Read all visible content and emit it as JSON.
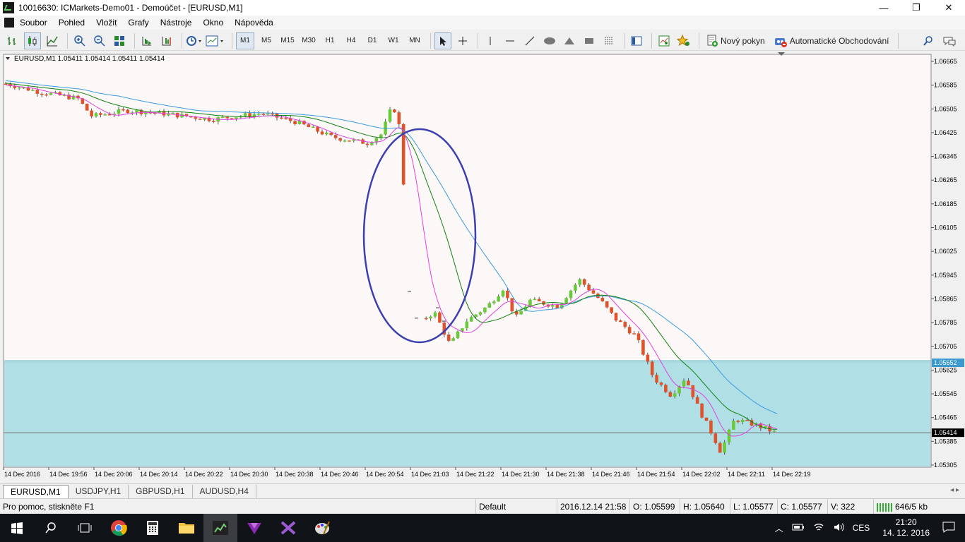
{
  "window": {
    "title": "10016630: ICMarkets-Demo01 - Demoúčet - [EURUSD,M1]",
    "controls": {
      "minimize": "—",
      "maximize": "❐",
      "close": "✕"
    },
    "mdi": {
      "minimize": "_",
      "restore": "❐",
      "close": "✕"
    }
  },
  "menu": [
    "Soubor",
    "Pohled",
    "Vložit",
    "Grafy",
    "Nástroje",
    "Okno",
    "Nápověda"
  ],
  "toolbar": {
    "timeframes": [
      "M1",
      "M5",
      "M15",
      "M30",
      "H1",
      "H4",
      "D1",
      "W1",
      "MN"
    ],
    "active_timeframe": "M1",
    "new_order": "Nový pokyn",
    "auto_trading": "Automatické Obchodování"
  },
  "chart": {
    "header": "EURUSD,M1  1.05411 1.05414 1.05411 1.05414",
    "price_labels": [
      "1.06665",
      "1.06585",
      "1.06505",
      "1.06425",
      "1.06345",
      "1.06265",
      "1.06185",
      "1.06105",
      "1.06025",
      "1.05945",
      "1.05865",
      "1.05785",
      "1.05705",
      "1.05625",
      "1.05545",
      "1.05465",
      "1.05385",
      "1.05305"
    ],
    "time_labels": [
      "14 Dec 2016",
      "14 Dec 19:56",
      "14 Dec 20:06",
      "14 Dec 20:14",
      "14 Dec 20:22",
      "14 Dec 20:30",
      "14 Dec 20:38",
      "14 Dec 20:46",
      "14 Dec 20:54",
      "14 Dec 21:03",
      "14 Dec 21:22",
      "14 Dec 21:30",
      "14 Dec 21:38",
      "14 Dec 21:46",
      "14 Dec 21:54",
      "14 Dec 22:02",
      "14 Dec 22:11",
      "14 Dec 22:19"
    ],
    "zone_price_label": "1.05652",
    "current_price_label": "1.05414",
    "colors": {
      "bull": "#6aca3c",
      "bear": "#e0522a",
      "ma_fast": "#e040e0",
      "ma_mid": "#108010",
      "ma_slow": "#3a9ae0",
      "zone": "#b0dfe6",
      "ellipse": "#3b3fb0"
    }
  },
  "tabs": [
    "EURUSD,M1",
    "USDJPY,H1",
    "GBPUSD,H1",
    "AUDUSD,H4"
  ],
  "status": {
    "help": "Pro pomoc, stiskněte F1",
    "profile": "Default",
    "datetime": "2016.12.14 21:58",
    "open": "O: 1.05599",
    "high": "H: 1.05640",
    "low": "L: 1.05577",
    "close": "C: 1.05577",
    "volume": "V: 322",
    "traffic": "646/5 kb"
  },
  "taskbar": {
    "lang": "CES",
    "time": "21:20",
    "date": "14. 12. 2016"
  }
}
